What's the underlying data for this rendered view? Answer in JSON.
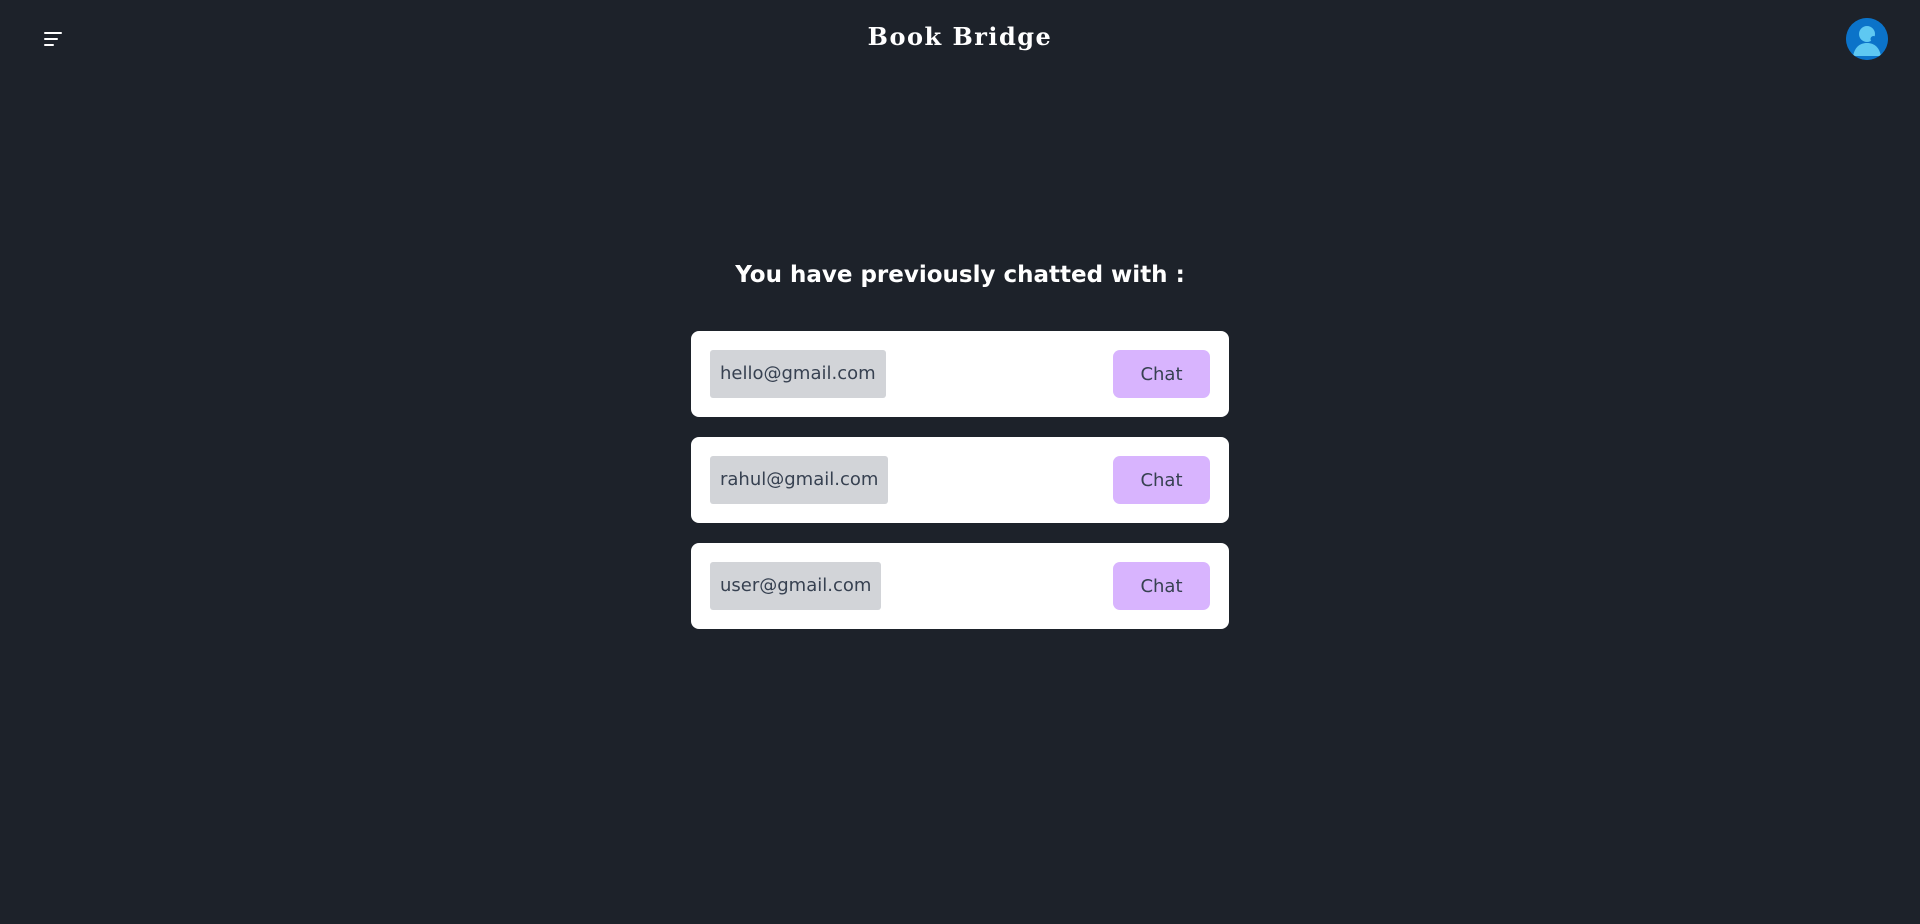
{
  "header": {
    "brand": "Book Bridge",
    "menu_icon": "hamburger-menu-icon",
    "avatar_icon": "user-avatar-icon"
  },
  "main": {
    "title": "You have previously chatted with :",
    "contacts": [
      {
        "email": "hello@gmail.com",
        "action_label": "Chat"
      },
      {
        "email": "rahul@gmail.com",
        "action_label": "Chat"
      },
      {
        "email": "user@gmail.com",
        "action_label": "Chat"
      }
    ]
  },
  "colors": {
    "background": "#1d222a",
    "card": "#ffffff",
    "email_chip": "#d2d4d8",
    "chat_button": "#d8b4fe",
    "avatar": "#0b73c9"
  }
}
